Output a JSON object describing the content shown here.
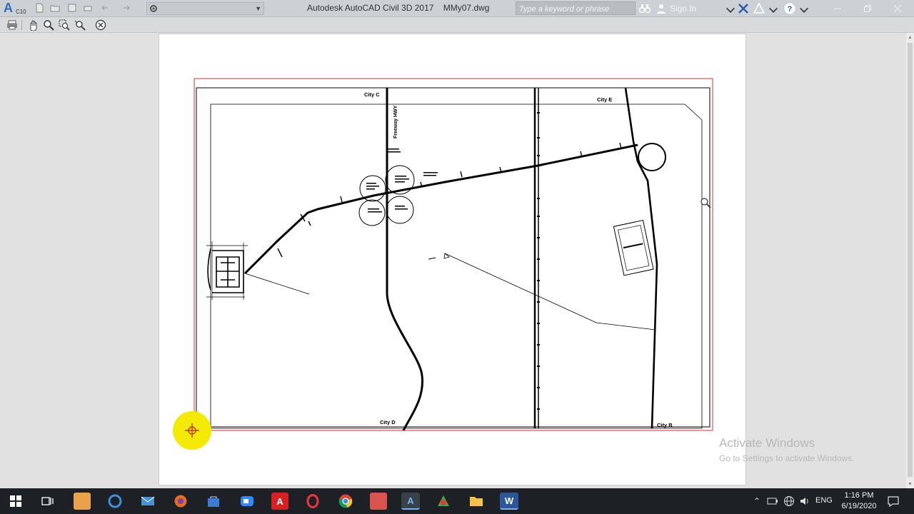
{
  "app": {
    "title": "Autodesk AutoCAD Civil 3D 2017    MMy07.dwg",
    "logo_letter": "A",
    "logo_version": "C10",
    "workspace": "",
    "search_placeholder": "Type a keyword or phrase",
    "sign_in": "Sign In"
  },
  "drawing": {
    "labels": {
      "city_c": "City C",
      "city_e": "City E",
      "city_d": "City D",
      "city_b": "City B",
      "highway": "Freeway HWY"
    }
  },
  "watermark": {
    "line1": "Activate Windows",
    "line2": "Go to Settings to activate Windows."
  },
  "taskbar": {
    "lang": "ENG",
    "time": "1:16 PM",
    "date": "6/19/2020",
    "autocad_letter": "A",
    "word_letter": "W"
  },
  "colors": {
    "title_bar": "#cdd0d4",
    "taskbar": "#1d2126",
    "viewport_border": "#e03030",
    "cursor_highlight": "#f5ea05"
  }
}
